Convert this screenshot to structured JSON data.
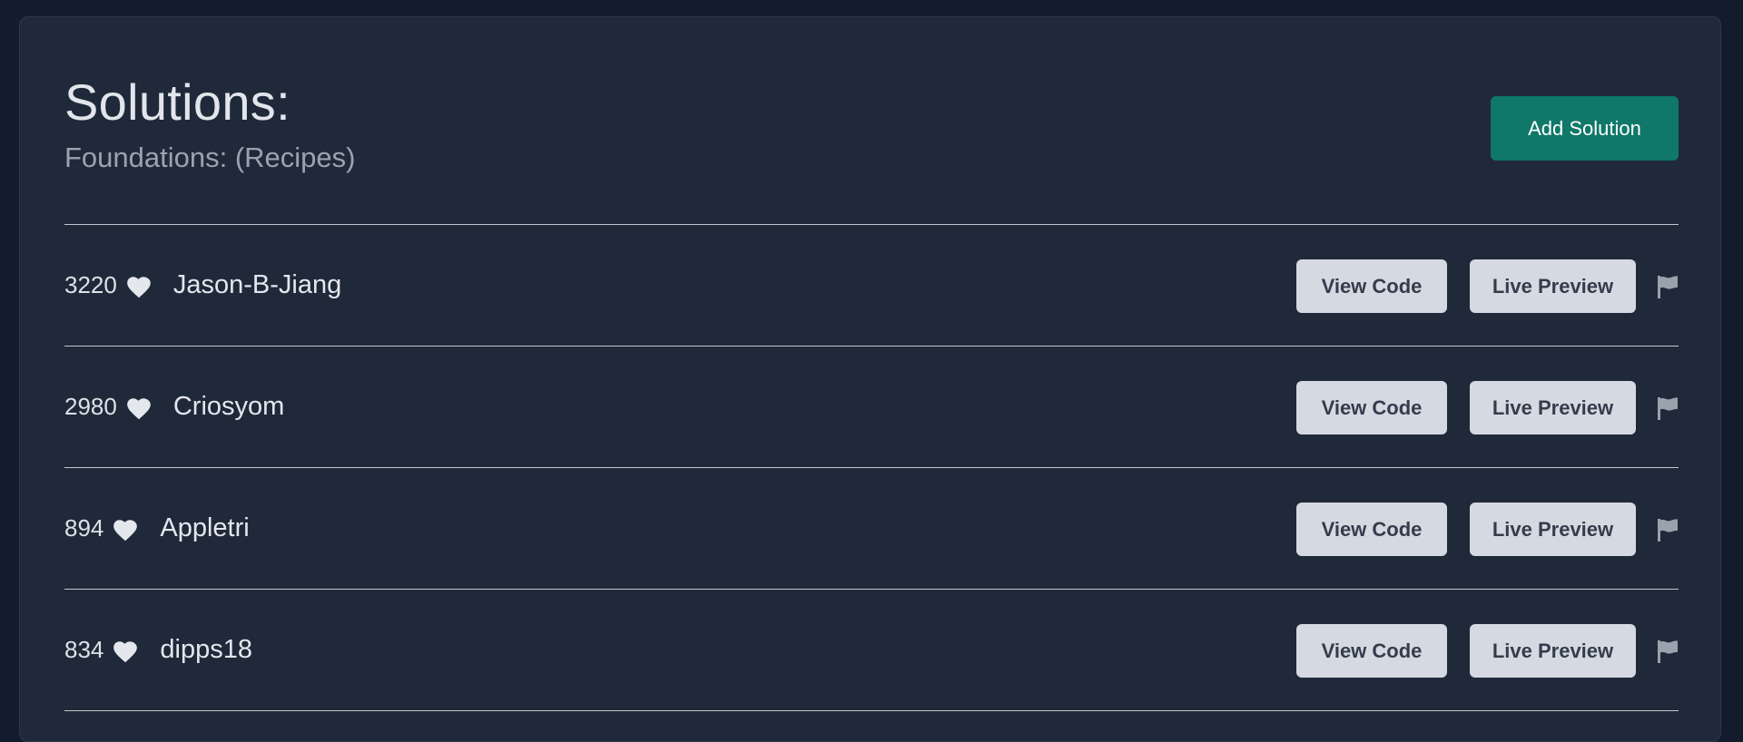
{
  "header": {
    "title": "Solutions:",
    "subtitle": "Foundations: (Recipes)",
    "add_button_label": "Add Solution"
  },
  "colors": {
    "accent": "#0f7869",
    "background": "#131c2c",
    "card": "#202939"
  },
  "icons": {
    "like": "heart-icon",
    "report": "flag-icon"
  },
  "solutions": [
    {
      "likes": "3220",
      "author": "Jason-B-Jiang",
      "view_code_label": "View Code",
      "live_preview_label": "Live Preview"
    },
    {
      "likes": "2980",
      "author": "Criosyom",
      "view_code_label": "View Code",
      "live_preview_label": "Live Preview"
    },
    {
      "likes": "894",
      "author": "Appletri",
      "view_code_label": "View Code",
      "live_preview_label": "Live Preview"
    },
    {
      "likes": "834",
      "author": "dipps18",
      "view_code_label": "View Code",
      "live_preview_label": "Live Preview"
    }
  ]
}
